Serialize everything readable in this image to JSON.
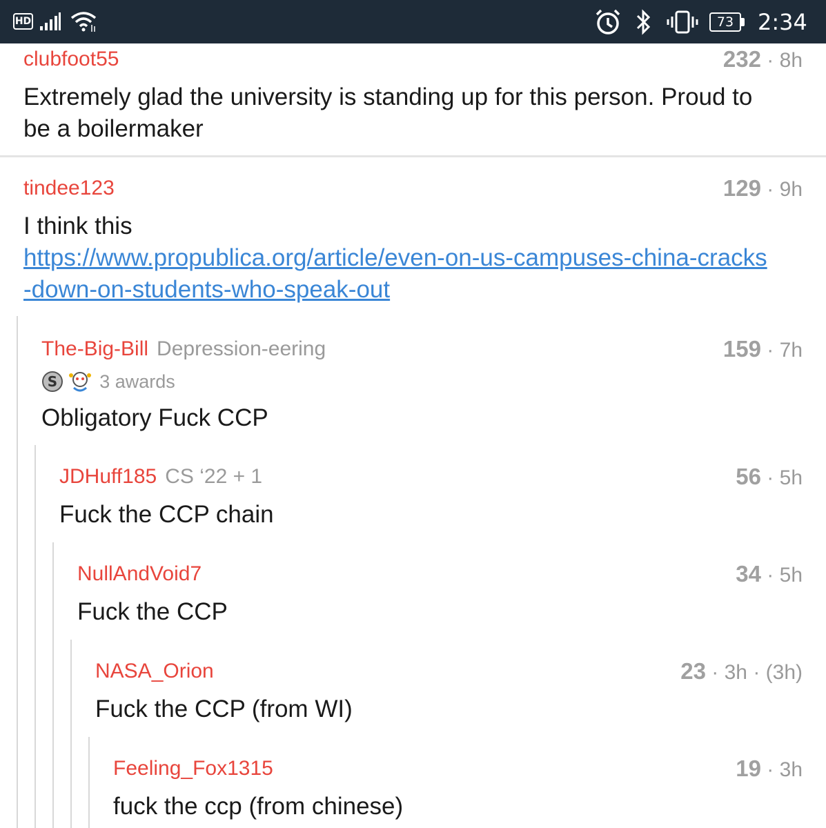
{
  "status_bar": {
    "hd": "HD",
    "battery": "73",
    "time": "2:34",
    "icons": [
      "hd-badge-icon",
      "signal-icon",
      "wifi-icon",
      "alarm-icon",
      "bluetooth-icon",
      "vibrate-icon",
      "battery-icon"
    ]
  },
  "comments": [
    {
      "author": "clubfoot55",
      "flair": "",
      "score": "232",
      "age": " · 8h",
      "text_lines": [
        "Extremely glad the university is standing up for this person. Proud to",
        "be a boilermaker"
      ]
    },
    {
      "author": "tindee123",
      "flair": "",
      "score": "129",
      "age": " · 9h",
      "text": "I think this",
      "link_line1": "https://www.propublica.org/article/even-on-us-campuses-china-cracks",
      "link_line2": "-down-on-students-who-speak-out"
    },
    {
      "author": "The-Big-Bill",
      "flair": "Depression-eering",
      "score": "159",
      "age": " · 7h",
      "awards": "3 awards",
      "text": "Obligatory Fuck CCP"
    },
    {
      "author": "JDHuff185",
      "flair": "CS ‘22 + 1",
      "score": "56",
      "age": " · 5h",
      "text": "Fuck the CCP chain"
    },
    {
      "author": "NullAndVoid7",
      "flair": "",
      "score": "34",
      "age": " · 5h",
      "text": "Fuck the CCP"
    },
    {
      "author": "NASA_Orion",
      "flair": "",
      "score": "23",
      "age": " · 3h · (3h)",
      "text": "Fuck the CCP (from WI)"
    },
    {
      "author": "Feeling_Fox1315",
      "flair": "",
      "score": "19",
      "age": " · 3h",
      "text": "fuck the ccp (from chinese)"
    }
  ],
  "colors": {
    "status_bar_bg": "#1e2b38",
    "author": "#e8453c",
    "link": "#3a86d6",
    "meta": "#9a9a9a"
  }
}
